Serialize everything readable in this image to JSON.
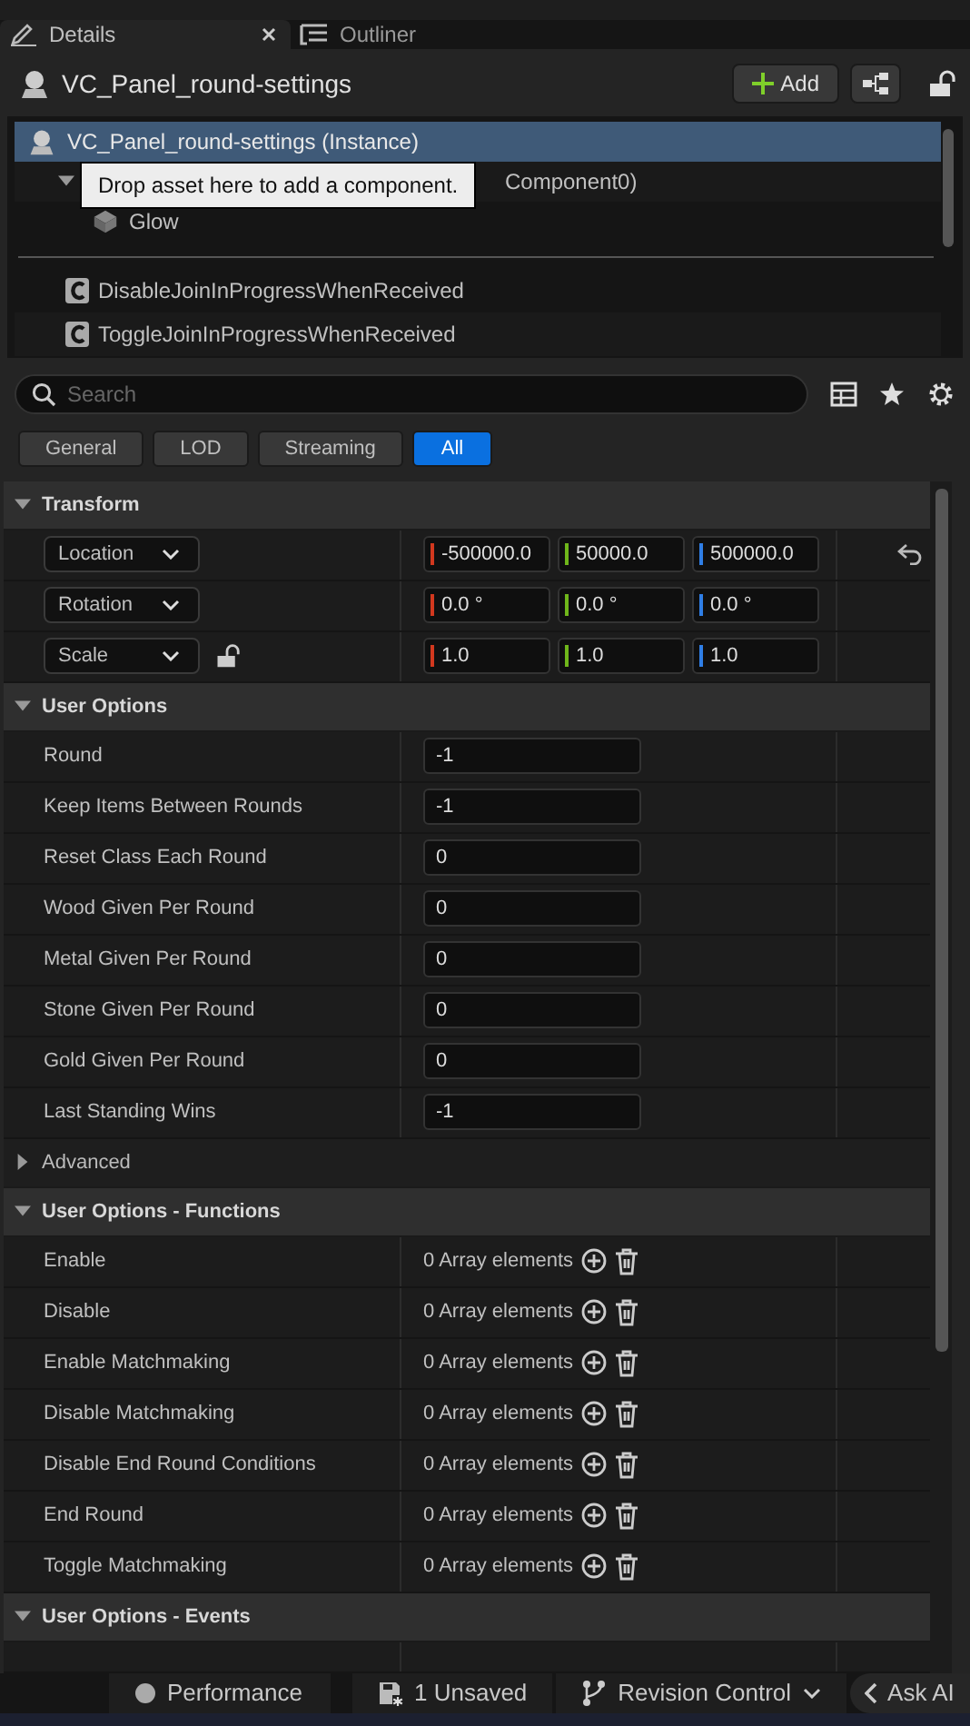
{
  "tabs": [
    {
      "label": "Details",
      "selected": true
    },
    {
      "label": "Outliner",
      "selected": false
    }
  ],
  "header": {
    "title": "VC_Panel_round-settings",
    "add_button": "Add",
    "locked": false
  },
  "components": {
    "tree": [
      {
        "label": "VC_Panel_round-settings (Instance)",
        "selected": true,
        "children": [
          {
            "label": "Component0)",
            "selected": false,
            "expanded": true,
            "children": [
              {
                "label": "Glow",
                "selected": false
              }
            ]
          }
        ]
      }
    ],
    "tooltip": "Drop asset here to add a component.",
    "functions": [
      "DisableJoinInProgressWhenReceived",
      "ToggleJoinInProgressWhenReceived"
    ]
  },
  "search": {
    "placeholder": "Search"
  },
  "filters": [
    {
      "label": "General",
      "selected": false
    },
    {
      "label": "LOD",
      "selected": false
    },
    {
      "label": "Streaming",
      "selected": false
    },
    {
      "label": "All",
      "selected": true
    }
  ],
  "sections": [
    {
      "kind": "category",
      "title": "Transform",
      "expanded": true,
      "rows": [
        {
          "kind": "vector",
          "label": "Location",
          "values": [
            "-500000.0",
            "50000.0",
            "500000.0"
          ],
          "reset": true
        },
        {
          "kind": "vector",
          "label": "Rotation",
          "values": [
            "0.0 °",
            "0.0 °",
            "0.0 °"
          ]
        },
        {
          "kind": "vector",
          "label": "Scale",
          "values": [
            "1.0",
            "1.0",
            "1.0"
          ],
          "locked": false
        }
      ]
    },
    {
      "kind": "category",
      "title": "User Options",
      "expanded": true,
      "rows": [
        {
          "kind": "text",
          "label": "Round",
          "value": "-1"
        },
        {
          "kind": "text",
          "label": "Keep Items Between Rounds",
          "value": "-1"
        },
        {
          "kind": "text",
          "label": "Reset Class Each Round",
          "value": "0"
        },
        {
          "kind": "text",
          "label": "Wood Given Per Round",
          "value": "0"
        },
        {
          "kind": "text",
          "label": "Metal Given Per Round",
          "value": "0"
        },
        {
          "kind": "text",
          "label": "Stone Given Per Round",
          "value": "0"
        },
        {
          "kind": "text",
          "label": "Gold Given Per Round",
          "value": "0"
        },
        {
          "kind": "text",
          "label": "Last Standing Wins",
          "value": "-1"
        }
      ]
    },
    {
      "kind": "subgroup",
      "title": "Advanced",
      "expanded": false
    },
    {
      "kind": "category",
      "title": "User Options - Functions",
      "expanded": true,
      "rows": [
        {
          "kind": "array",
          "label": "Enable",
          "value": "0 Array elements"
        },
        {
          "kind": "array",
          "label": "Disable",
          "value": "0 Array elements"
        },
        {
          "kind": "array",
          "label": "Enable Matchmaking",
          "value": "0 Array elements"
        },
        {
          "kind": "array",
          "label": "Disable Matchmaking",
          "value": "0 Array elements"
        },
        {
          "kind": "array",
          "label": "Disable End Round Conditions",
          "value": "0 Array elements"
        },
        {
          "kind": "array",
          "label": "End Round",
          "value": "0 Array elements"
        },
        {
          "kind": "array",
          "label": "Toggle Matchmaking",
          "value": "0 Array elements"
        }
      ]
    },
    {
      "kind": "category",
      "title": "User Options - Events",
      "expanded": true
    }
  ],
  "status_bar": [
    {
      "kind": "performance",
      "label": "Performance"
    },
    {
      "kind": "unsaved",
      "label": "1 Unsaved"
    },
    {
      "kind": "revision",
      "label": "Revision Control"
    },
    {
      "kind": "ai",
      "label": "Ask AI"
    }
  ]
}
